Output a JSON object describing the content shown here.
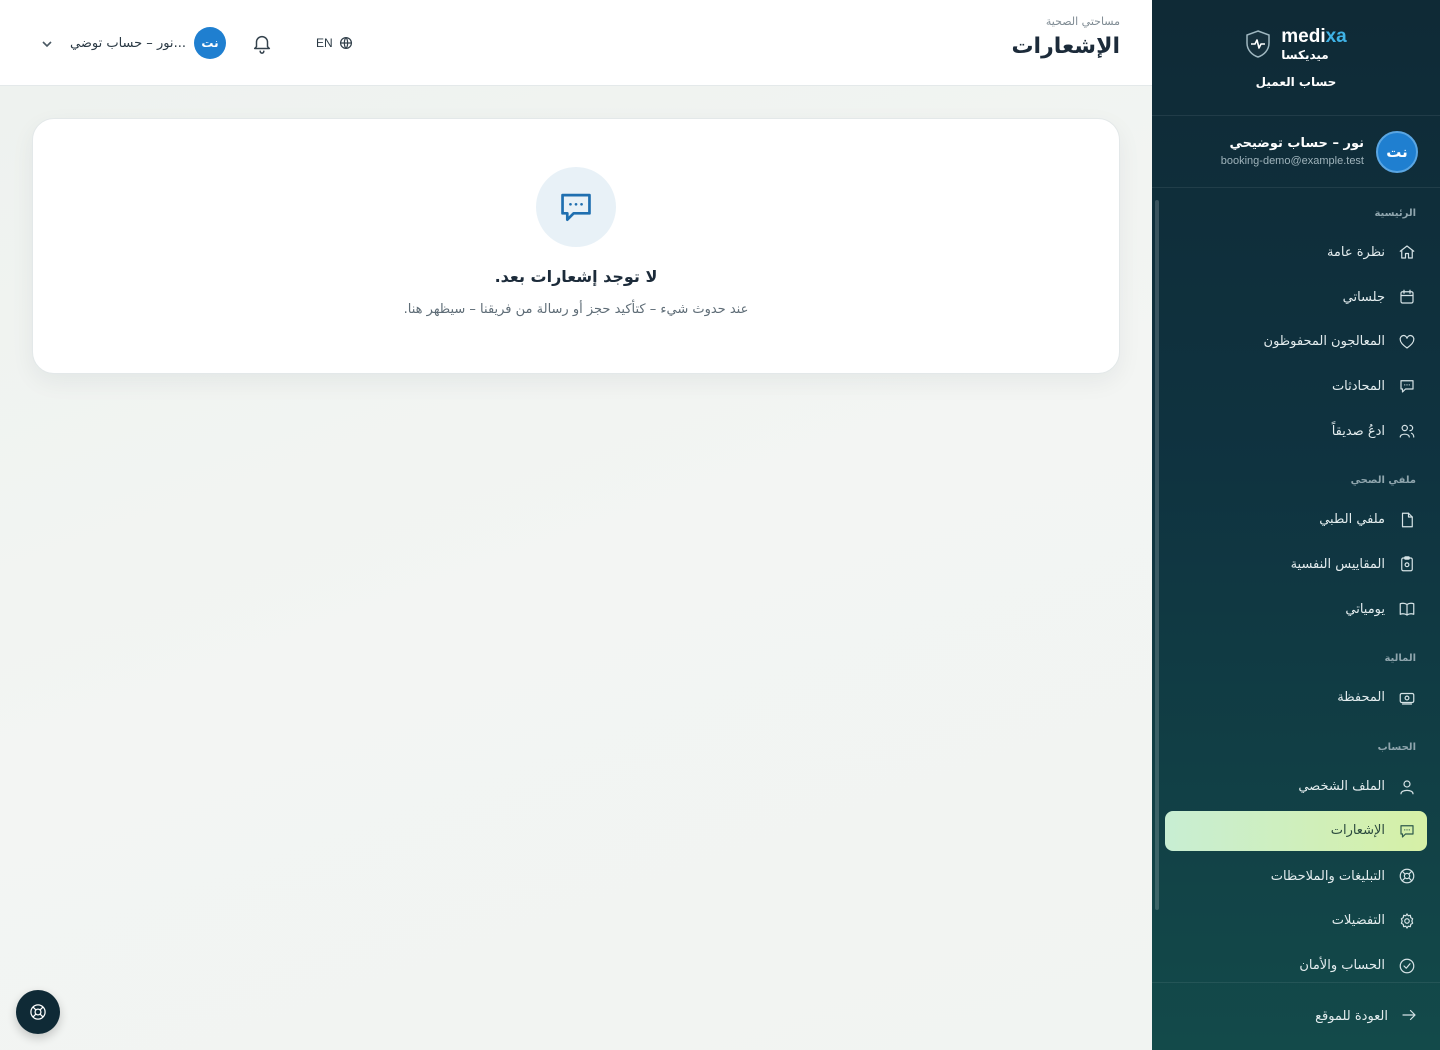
{
  "brand": {
    "name_en_a": "medi",
    "name_en_b": "xa",
    "name_ar": "ميديكسا",
    "subtitle": "حساب العميل",
    "accent": "#3fb3e6"
  },
  "user": {
    "initials": "نت",
    "name": "نور – حساب توضيحي",
    "email": "booking-demo@example.test"
  },
  "header": {
    "breadcrumb": "مساحتي الصحية",
    "title": "الإشعارات",
    "account_label": "نور – حساب توضي...",
    "account_initials": "نت",
    "lang": "EN"
  },
  "sections": {
    "main": "الرئيسية",
    "health": "ملفي الصحي",
    "finance": "المالية",
    "account": "الحساب"
  },
  "nav": {
    "overview": "نظرة عامة",
    "sessions": "جلساتي",
    "saved": "المعالجون المحفوظون",
    "chats": "المحادثات",
    "invite": "ادعُ صديقاً",
    "record": "ملفي الطبي",
    "scales": "المقاييس النفسية",
    "journal": "يومياتي",
    "wallet": "المحفظة",
    "profile": "الملف الشخصي",
    "notifications": "الإشعارات",
    "reports": "التبليغات والملاحظات",
    "preferences": "التفضيلات",
    "security": "الحساب والأمان",
    "back": "العودة للموقع"
  },
  "active_item": "notifications",
  "empty_state": {
    "title": "لا توجد إشعارات بعد.",
    "description": "عند حدوث شيء – كتأكيد حجز أو رسالة من فريقنا – سيظهر هنا."
  },
  "colors": {
    "sidebar_bg": "#0f2a36",
    "active_bg": "#d6f0a6",
    "avatar": "#1f7fd0"
  }
}
